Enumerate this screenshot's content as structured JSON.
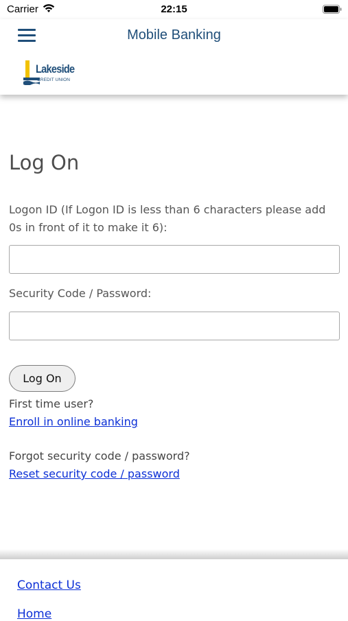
{
  "status_bar": {
    "carrier": "Carrier",
    "time": "22:15",
    "icons": [
      "wifi-icon",
      "battery-icon"
    ]
  },
  "header": {
    "title": "Mobile Banking",
    "menu_icon": "hamburger-menu-icon",
    "logo": {
      "name": "Lakeside",
      "subtitle": "CREDIT UNION"
    }
  },
  "login": {
    "title": "Log On",
    "logon_id_label": "Logon ID (If Logon ID is less than 6 characters please add 0s in front of it to make it 6):",
    "logon_id_value": "",
    "password_label": "Security Code / Password:",
    "password_value": "",
    "submit_label": "Log On",
    "first_time_text": "First time user?",
    "enroll_link": "Enroll in online banking",
    "forgot_text": "Forgot security code / password?",
    "reset_link": "Reset security code / password"
  },
  "footer": {
    "links": [
      "Contact Us",
      "Home"
    ]
  },
  "colors": {
    "brand_blue": "#1f4e79",
    "link_blue": "#0b2fd6",
    "logo_yellow": "#f2c200"
  }
}
